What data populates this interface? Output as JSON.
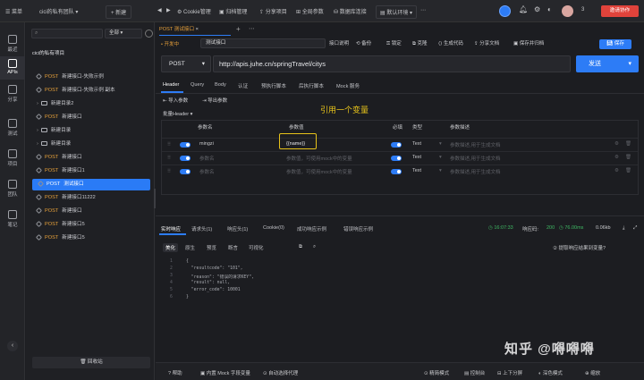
{
  "topbar": {
    "menu": "菜单",
    "team": "cici的私有团队",
    "new_label": "+ 新建",
    "tabs": [
      "Cookie管理",
      "归档管理",
      "分享项目",
      "全局参数",
      "数据库连接",
      "默认环境"
    ],
    "notif_count": "3",
    "invite_label": "邀请协作"
  },
  "nav": [
    "最近",
    "APIs",
    "分享",
    "测试",
    "项目",
    "团队",
    "笔记"
  ],
  "tree": {
    "search_placeholder": "",
    "filter": "全部",
    "project": "cici的私有项目",
    "items": [
      {
        "method": "POST",
        "name": "新建接口-失败示例",
        "kind": "api"
      },
      {
        "method": "POST",
        "name": "新建接口-失败示例 副本",
        "kind": "api"
      },
      {
        "method": "",
        "name": "新建目录2",
        "kind": "folder"
      },
      {
        "method": "POST",
        "name": "新建接口",
        "kind": "api"
      },
      {
        "method": "",
        "name": "新建目录",
        "kind": "folder"
      },
      {
        "method": "",
        "name": "新建目录",
        "kind": "folder"
      },
      {
        "method": "POST",
        "name": "新建接口",
        "kind": "api"
      },
      {
        "method": "POST",
        "name": "新建接口1",
        "kind": "api"
      },
      {
        "method": "POST",
        "name": "测试接口",
        "kind": "api",
        "selected": true
      },
      {
        "method": "POST",
        "name": "新建接口11222",
        "kind": "api"
      },
      {
        "method": "POST",
        "name": "新建接口",
        "kind": "api"
      },
      {
        "method": "POST",
        "name": "新建接口5",
        "kind": "api"
      },
      {
        "method": "POST",
        "name": "新建接口5",
        "kind": "api"
      }
    ],
    "recycle": "回收站"
  },
  "editor": {
    "tab_title": "POST 测试接口",
    "status": "• 开发中",
    "name": "测试接口",
    "actions": [
      "接口说明",
      "备份",
      "锁定",
      "克隆",
      "生成代码",
      "分享文档",
      "保存并归档"
    ],
    "save": "保存",
    "method": "POST",
    "url": "http://apis.juhe.cn/springTravel/citys",
    "send": "发送",
    "req_tabs": [
      "Header",
      "Query",
      "Body",
      "认证",
      "预执行脚本",
      "后执行脚本",
      "Mock 服务"
    ],
    "import": "导入参数",
    "export": "导出参数",
    "section": "批量Header",
    "annotation": "引用一个变量",
    "cols": [
      "参数名",
      "参数值",
      "必填",
      "类型",
      "参数描述"
    ],
    "rows": [
      {
        "name": "mingzi",
        "value": "{{name}}",
        "type": "Text",
        "desc": "参数描述,用于生成文档",
        "placeholder_name": false
      },
      {
        "name": "参数名",
        "value": "参数值，可使用mock中的变量",
        "type": "Text",
        "desc": "参数描述,用于生成文档",
        "placeholder_name": true
      },
      {
        "name": "参数名",
        "value": "参数值，可使用mock中的变量",
        "type": "Text",
        "desc": "参数描述,用于生成文档",
        "placeholder_name": true
      }
    ]
  },
  "response": {
    "tabs": [
      "实时响应",
      "请求头(1)",
      "响应头(1)",
      "Cookie(0)",
      "成功响应示例",
      "错误响应示例"
    ],
    "time": "16:07:33",
    "code_label": "响应码:",
    "code": "200",
    "duration": "76.00ms",
    "size": "0.06kb",
    "view_tabs": [
      "美化",
      "原生",
      "预览",
      "断言",
      "可视化"
    ],
    "hint": "② 提取响应结果到变量?",
    "lines": [
      "{",
      "  \"resultcode\": \"101\",",
      "  \"reason\": \"错误的请求KEY\",",
      "  \"result\": null,",
      "  \"error_code\": 10001",
      "}"
    ]
  },
  "bottombar": {
    "left": [
      "帮助",
      "内置 Mock 字段变量",
      "自动选择代理"
    ],
    "right": [
      "精简模式",
      "控制台",
      "上下分屏",
      "深色模式",
      "缩放"
    ]
  },
  "watermark": "知乎 @嘚嘚嘚",
  "colors": {
    "accent": "#2d7cf6",
    "highlight": "#e6c21a",
    "post": "#e9a23b",
    "danger": "#e0433b"
  }
}
